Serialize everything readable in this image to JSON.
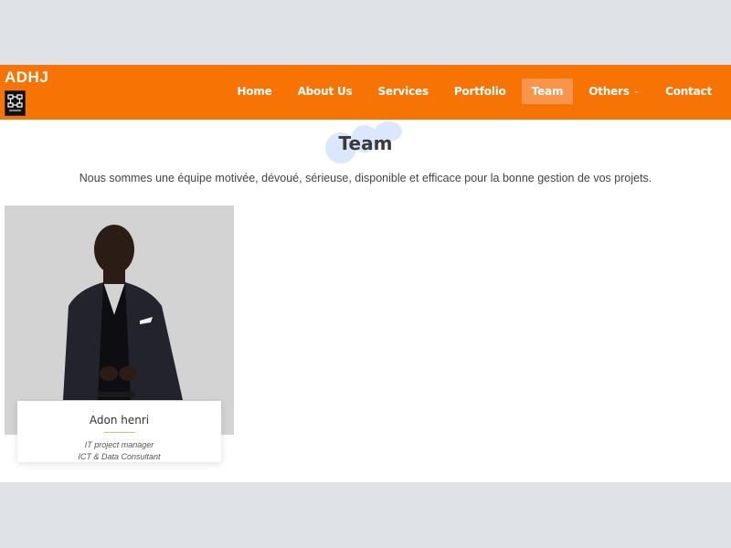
{
  "brand": {
    "name": "ADHJ"
  },
  "nav": {
    "items": [
      {
        "label": "Home"
      },
      {
        "label": "About Us"
      },
      {
        "label": "Services"
      },
      {
        "label": "Portfolio"
      },
      {
        "label": "Team",
        "active": true
      },
      {
        "label": "Others",
        "has_dropdown": true
      },
      {
        "label": "Contact"
      }
    ]
  },
  "section": {
    "title": "Team",
    "subtitle": "Nous sommes une équipe motivée, dévoué, sérieuse, disponible et efficace pour la bonne gestion de vos projets."
  },
  "team": [
    {
      "name": "Adon henri",
      "role_line1": "IT project manager",
      "role_line2": "ICT & Data Consultant"
    }
  ],
  "colors": {
    "nav_bg": "#f77304",
    "nav_active_bg": "#f9954a",
    "page_bg": "#dfe2e6",
    "content_bg": "#ffffff"
  }
}
